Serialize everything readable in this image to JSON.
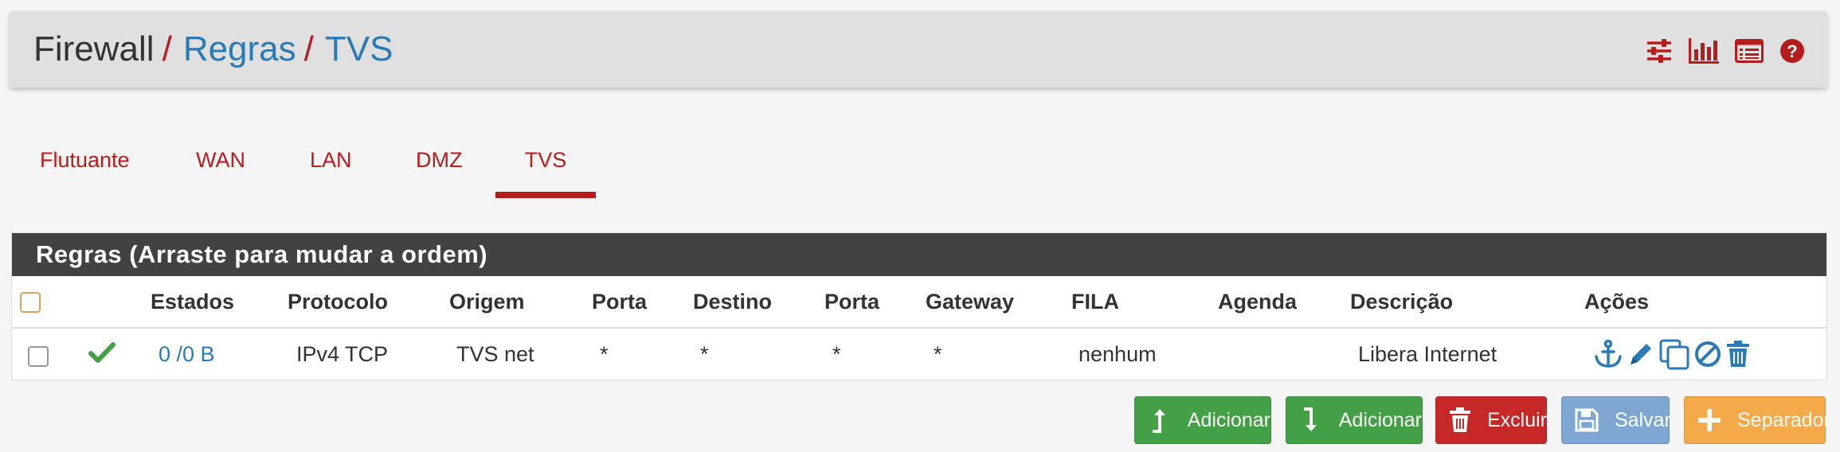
{
  "breadcrumb": {
    "root": "Firewall",
    "level2": "Regras",
    "level3": "TVS",
    "separator": "/"
  },
  "header_icons": [
    "sliders-icon",
    "bar-chart-icon",
    "list-icon",
    "help-icon"
  ],
  "tabs": [
    {
      "label": "Flutuante",
      "active": false
    },
    {
      "label": "WAN",
      "active": false
    },
    {
      "label": "LAN",
      "active": false
    },
    {
      "label": "DMZ",
      "active": false
    },
    {
      "label": "TVS",
      "active": true
    }
  ],
  "panel": {
    "title": "Regras (Arraste para mudar a ordem)",
    "columns": [
      "Estados",
      "Protocolo",
      "Origem",
      "Porta",
      "Destino",
      "Porta",
      "Gateway",
      "FILA",
      "Agenda",
      "Descrição",
      "Ações"
    ],
    "rows": [
      {
        "enabled": true,
        "estados": "0 /0 B",
        "protocolo": "IPv4 TCP",
        "origem": "TVS net",
        "porta_origem": "*",
        "destino": "*",
        "porta_destino": "*",
        "gateway": "*",
        "fila": "nenhum",
        "agenda": "",
        "descricao": "Libera Internet",
        "action_icons": [
          "anchor-icon",
          "pencil-icon",
          "copy-icon",
          "disable-icon",
          "trash-icon"
        ]
      }
    ]
  },
  "buttons": {
    "add_top": "Adicionar",
    "add_bottom": "Adicionar",
    "delete": "Excluir",
    "save": "Salvar",
    "separator": "Separador"
  },
  "colors": {
    "accent_red": "#b71c1c",
    "link_blue": "#2b7ab8",
    "panel_header": "#424242",
    "button_green": "#43a047",
    "button_red": "#c62828",
    "button_blue": "#7ea6d3",
    "button_orange": "#f4a94b"
  }
}
